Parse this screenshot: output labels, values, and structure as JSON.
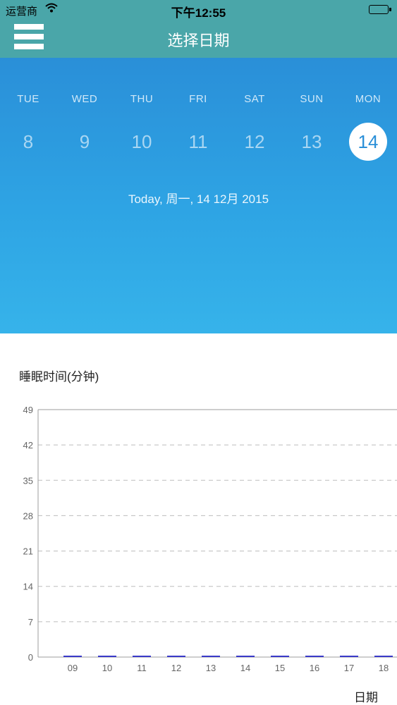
{
  "status_bar": {
    "carrier": "运营商",
    "time": "下午12:55"
  },
  "nav": {
    "title": "选择日期",
    "menu_icon": "hamburger-menu-icon"
  },
  "calendar": {
    "weekdays": [
      "TUE",
      "WED",
      "THU",
      "FRI",
      "SAT",
      "SUN",
      "MON"
    ],
    "days": [
      "8",
      "9",
      "10",
      "11",
      "12",
      "13",
      "14"
    ],
    "selected_day": "14",
    "today_label": "Today, 周一, 14 12月 2015"
  },
  "chart_data": {
    "type": "bar",
    "title": "睡眠时间(分钟)",
    "xlabel": "日期",
    "ylabel": "",
    "categories": [
      "09",
      "10",
      "11",
      "12",
      "13",
      "14",
      "15",
      "16",
      "17",
      "18"
    ],
    "values": [
      0,
      0,
      0,
      0,
      0,
      0,
      0,
      0,
      0,
      0
    ],
    "yticks": [
      0,
      7,
      14,
      21,
      28,
      35,
      42,
      49
    ],
    "ylim": [
      0,
      49
    ],
    "grid": true,
    "bar_color": "#3a3ac8"
  }
}
